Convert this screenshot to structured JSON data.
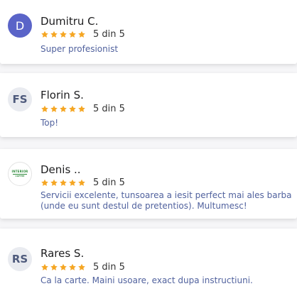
{
  "colors": {
    "star": "#f5a623",
    "comment_text": "#51629e",
    "name_text": "#1d1d1f",
    "avatar_solid": "#5a64c8",
    "avatar_light": "#e9ebf0"
  },
  "reviews": [
    {
      "initials": "D",
      "name": "Dumitru C.",
      "stars": 5,
      "score": "5 din 5",
      "comment": "Super profesionist"
    },
    {
      "initials": "FS",
      "name": "Florin S.",
      "stars": 5,
      "score": "5 din 5",
      "comment": "Top!"
    },
    {
      "avatar_logo": "INTERIOR COFFEE",
      "name": "Denis ..",
      "stars": 5,
      "score": "5 din 5",
      "comment": "Servicii excelente, tunsoarea a iesit perfect mai ales barba (unde eu sunt destul de pretentios). Multumesc!"
    },
    {
      "initials": "RS",
      "name": "Rares S.",
      "stars": 5,
      "score": "5 din 5",
      "comment": "Ca la carte. Maini usoare, exact dupa instructiuni."
    }
  ]
}
